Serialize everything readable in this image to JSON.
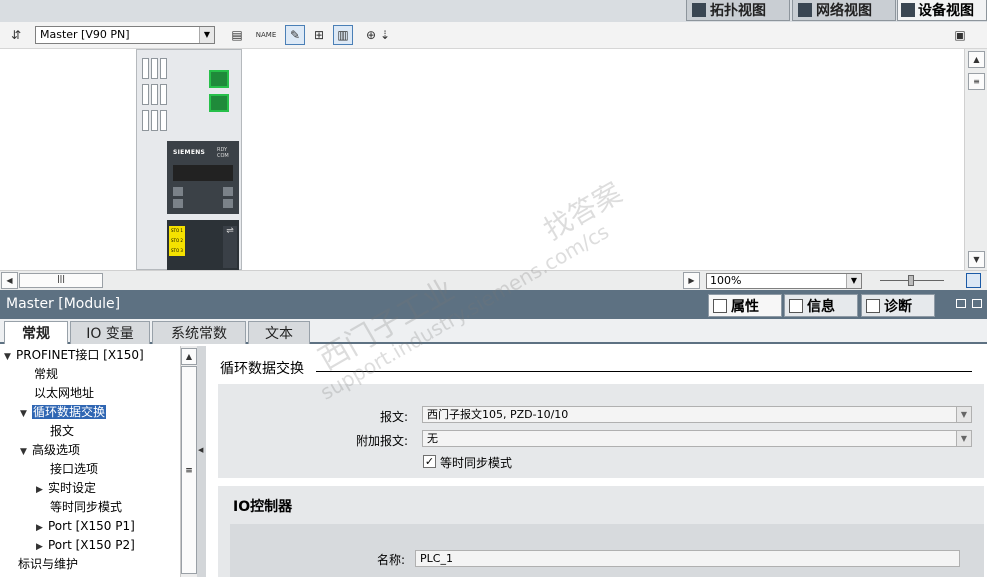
{
  "view_tabs": [
    {
      "label": "拓扑视图",
      "icon": "topology-icon"
    },
    {
      "label": "网络视图",
      "icon": "network-icon"
    },
    {
      "label": "设备视图",
      "icon": "device-icon",
      "active": true
    }
  ],
  "toolbar": {
    "device_select": "Master [V90 PN]"
  },
  "zoom": "100%",
  "inspector": {
    "title": "Master [Module]",
    "tabs": [
      {
        "label": "属性",
        "active": true
      },
      {
        "label": "信息"
      },
      {
        "label": "诊断"
      }
    ],
    "subtabs": [
      {
        "label": "常规",
        "active": true
      },
      {
        "label": "IO 变量"
      },
      {
        "label": "系统常数"
      },
      {
        "label": "文本"
      }
    ]
  },
  "nav_tree": [
    {
      "label": "PROFINET接口 [X150]",
      "toggle": "▼"
    },
    {
      "label": "常规",
      "toggle": ""
    },
    {
      "label": "以太网地址",
      "toggle": ""
    },
    {
      "label": "循环数据交换",
      "toggle": "▼",
      "selected": true
    },
    {
      "label": "报文",
      "toggle": ""
    },
    {
      "label": "高级选项",
      "toggle": "▼"
    },
    {
      "label": "接口选项",
      "toggle": ""
    },
    {
      "label": "实时设定",
      "toggle": "▶"
    },
    {
      "label": "等时同步模式",
      "toggle": ""
    },
    {
      "label": "Port [X150 P1]",
      "toggle": "▶"
    },
    {
      "label": "Port [X150 P2]",
      "toggle": "▶"
    },
    {
      "label": "标识与维护",
      "toggle": ""
    }
  ],
  "cyclic": {
    "section_title": "循环数据交换",
    "telegram_label": "报文:",
    "telegram_value": "西门子报文105, PZD-10/10",
    "extra_label": "附加报文:",
    "extra_value": "无",
    "isochronous_label": "等时同步模式",
    "isochronous_checked": "✓"
  },
  "io_controller": {
    "section_title": "IO控制器",
    "name_label": "名称:",
    "name_value": "PLC_1"
  },
  "device_image": {
    "brand": "SIEMENS",
    "leds": "RDY COM",
    "sto_lines": [
      "STO 1",
      "STO 2",
      "STO 3"
    ]
  },
  "watermark": {
    "line1": "找答案",
    "line2": "西门子工业",
    "line3": "support.industry.siemens.com/cs"
  }
}
